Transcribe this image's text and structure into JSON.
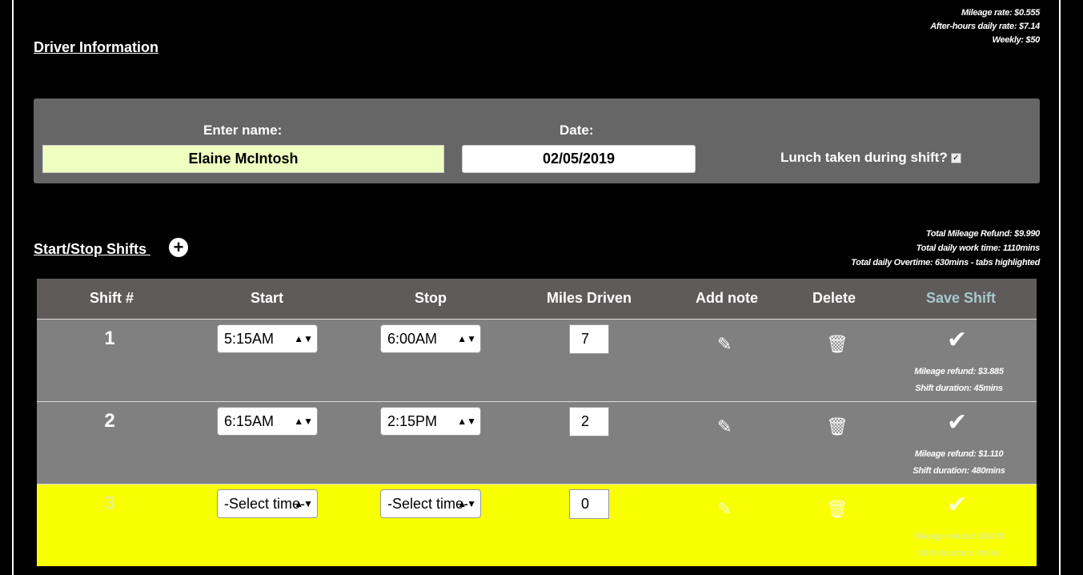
{
  "rates": {
    "mileage_rate": "Mileage rate: $0.555",
    "after_hours": "After-hours daily rate: $7.14",
    "weekly": "Weekly: $50"
  },
  "driver": {
    "title": "Driver Information",
    "name_label": "Enter name:",
    "name_value": "Elaine McIntosh",
    "date_label": "Date:",
    "date_value": "02/05/2019",
    "lunch_label": "Lunch taken during shift?",
    "lunch_checked": true
  },
  "shifts": {
    "title": "Start/Stop Shifts ",
    "add_icon": "plus-circle-icon",
    "totals": {
      "mileage_refund": "Total Mileage Refund: $9.990",
      "work_time": "Total daily work time: 1110mins",
      "overtime": "Total daily Overtime: 630mins - tabs highlighted"
    },
    "headers": {
      "shift_num": "Shift #",
      "start": "Start",
      "stop": "Stop",
      "miles": "Miles Driven",
      "note": "Add note",
      "delete": "Delete",
      "save": "Save Shift"
    },
    "save_header_color": "#a9c8cc",
    "highlight_color": "#f7ff00",
    "rows": [
      {
        "num": "1",
        "start": "5:15AM",
        "stop": "6:00AM",
        "miles": "7",
        "refund": "Mileage refund: $3.885",
        "duration": "Shift duration: 45mins",
        "highlighted": false
      },
      {
        "num": "2",
        "start": "6:15AM",
        "stop": "2:15PM",
        "miles": "2",
        "refund": "Mileage refund: $1.110",
        "duration": "Shift duration: 480mins",
        "highlighted": false
      },
      {
        "num": "3",
        "start": "-Select time-",
        "stop": "-Select time-",
        "miles": "0",
        "refund": "Mileage refund: $0.000",
        "duration": "Shift duration: 0mins",
        "highlighted": true
      }
    ]
  }
}
